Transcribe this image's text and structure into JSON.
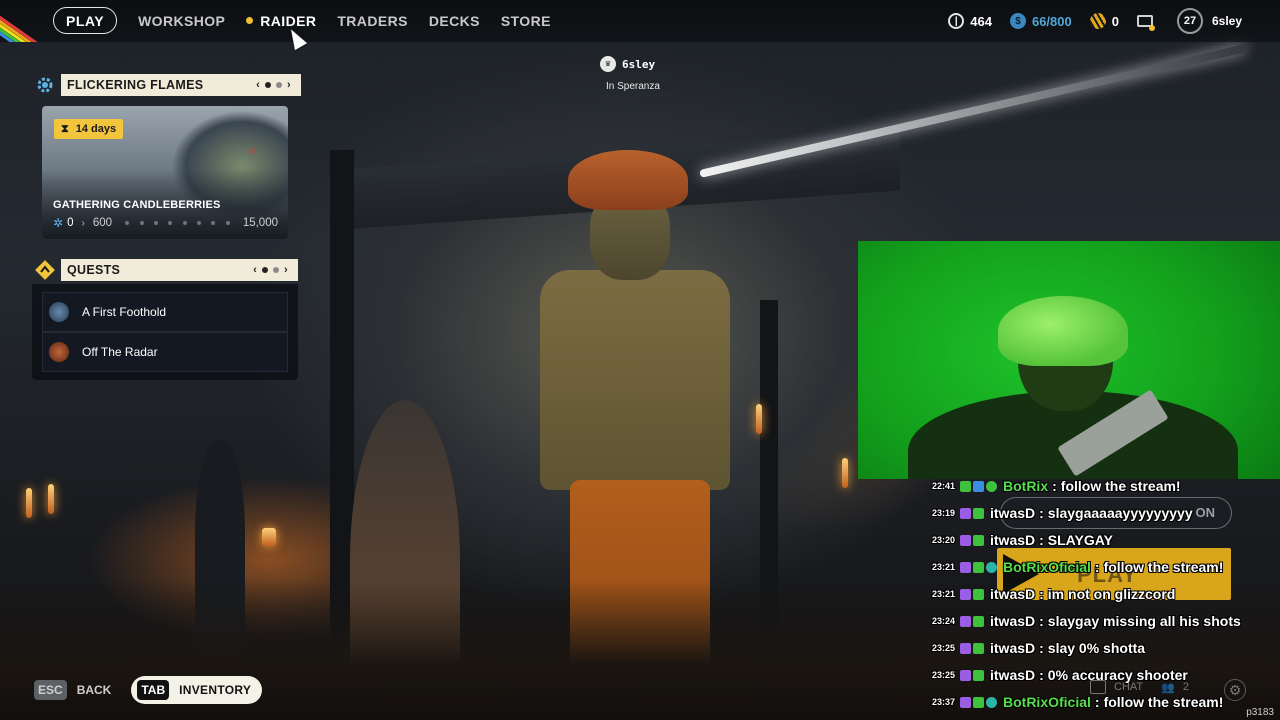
{
  "nav": {
    "play": "PLAY",
    "items": [
      "WORKSHOP",
      "RAIDER",
      "TRADERS",
      "DECKS",
      "STORE"
    ],
    "active": "RAIDER"
  },
  "stats": {
    "coins": "464",
    "blue": "66/800",
    "gold": "0",
    "level": "27",
    "username": "6sley"
  },
  "center_player": {
    "name": "6sley",
    "location": "In Speranza"
  },
  "event": {
    "title": "FLICKERING FLAMES",
    "days": "14  days",
    "card_title": "GATHERING CANDLEBERRIES",
    "progress_current": "0",
    "progress_mid": "600",
    "progress_max": "15,000"
  },
  "quests": {
    "title": "QUESTS",
    "items": [
      "A First Foothold",
      "Off The Radar"
    ]
  },
  "bottom": {
    "esc_key": "ESC",
    "back_label": "BACK",
    "tab_key": "TAB",
    "inventory_label": "INVENTORY"
  },
  "chat": {
    "messages": [
      {
        "time": "22:41",
        "user": "BotRix",
        "text": "follow the stream!",
        "bot": true
      },
      {
        "time": "23:19",
        "user": "itwasD",
        "text": "slaygaaaaayyyyyyyyy",
        "bot": false
      },
      {
        "time": "23:20",
        "user": "itwasD",
        "text": "SLAYGAY",
        "bot": false
      },
      {
        "time": "23:21",
        "user": "BotRixOficial",
        "text": "follow the stream!",
        "bot": true
      },
      {
        "time": "23:21",
        "user": "itwasD",
        "text": "im not on glizzcord",
        "bot": false
      },
      {
        "time": "23:24",
        "user": "itwasD",
        "text": "slaygay missing all his shots",
        "bot": false
      },
      {
        "time": "23:25",
        "user": "itwasD",
        "text": "slay 0% shotta",
        "bot": false
      },
      {
        "time": "23:25",
        "user": "itwasD",
        "text": "0% accuracy shooter",
        "bot": false
      },
      {
        "time": "23:37",
        "user": "BotRixOficial",
        "text": "follow the stream!",
        "bot": true
      }
    ],
    "overlay_on": "ON",
    "overlay_play": "PLAY",
    "chat_label": "CHAT",
    "people_count": "2",
    "stream_id": "p3183"
  },
  "colors": {
    "accent_yellow": "#f2c53c",
    "bot_green": "#55e04a",
    "blue_currency": "#4fa8d9",
    "panel_cream": "#f1ecd9"
  }
}
